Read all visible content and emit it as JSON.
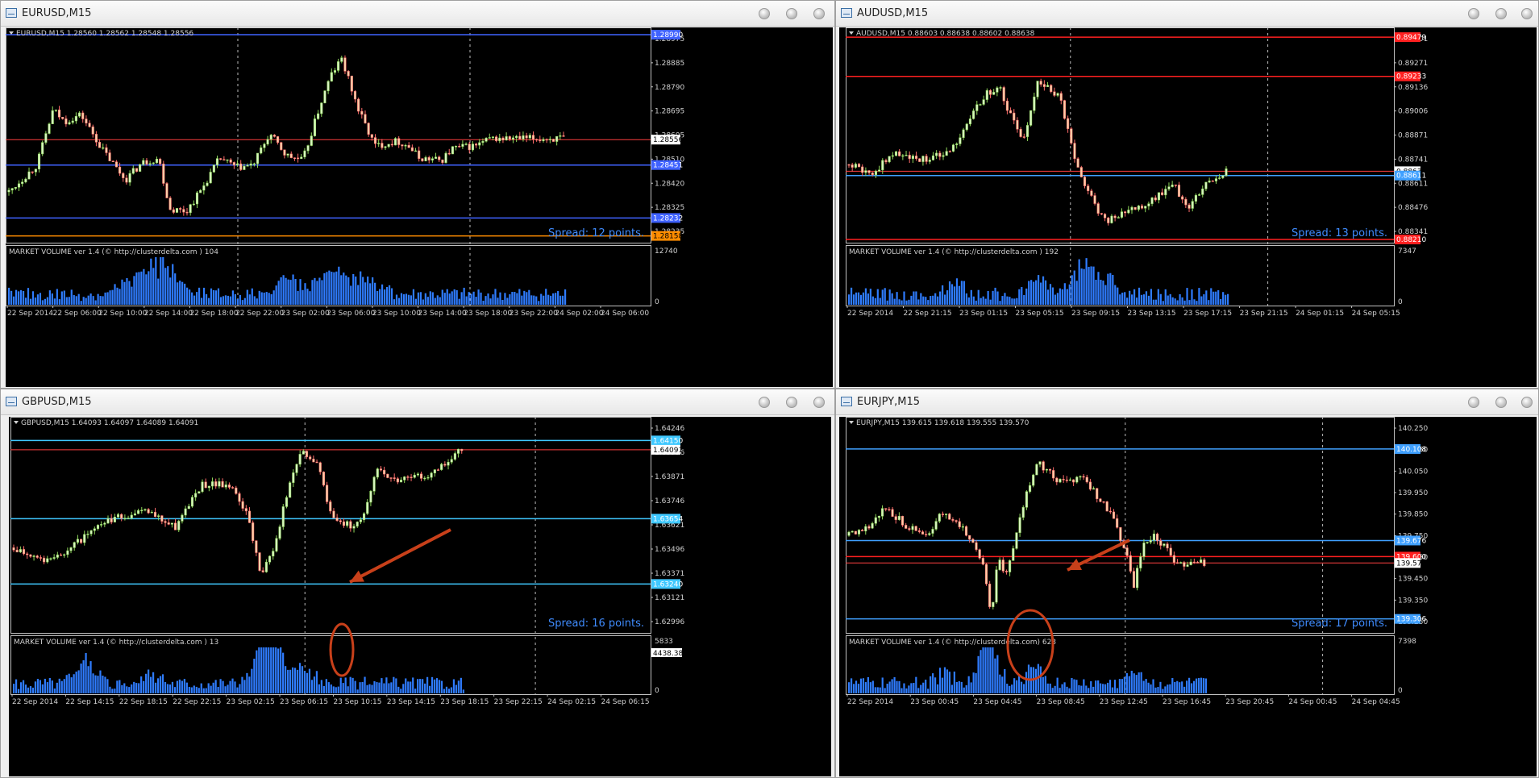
{
  "chart_data": [
    {
      "type": "candlestick",
      "window_title": "EURUSD,M15",
      "header": "EURUSD,M15  1.28560 1.28562 1.28548 1.28556",
      "yticks": [
        "1.28975",
        "1.28885",
        "1.28790",
        "1.28695",
        "1.28605",
        "1.28510",
        "1.28420",
        "1.28325",
        "1.28235"
      ],
      "ylim": [
        1.2813,
        1.2902
      ],
      "levels": [
        {
          "value": 1.2899,
          "label": "1.28990",
          "color": "#3f62ff"
        },
        {
          "value": 1.28556,
          "label": "1.28556",
          "color": "#ffffff"
        },
        {
          "value": 1.28451,
          "label": "1.28451",
          "color": "#3f62ff"
        },
        {
          "value": 1.28232,
          "label": "1.28232",
          "color": "#3f62ff"
        },
        {
          "value": 1.28158,
          "label": "1.28158",
          "color": "#ff8c00"
        }
      ],
      "spread": "Spread: 12 points.",
      "volume_header": "MARKET VOLUME ver 1.4 (© http://clusterdelta.com ) 104",
      "volume_max": "12740",
      "volume_min": "0",
      "xticks": [
        "22 Sep 2014",
        "22 Sep 06:00",
        "22 Sep 10:00",
        "22 Sep 14:00",
        "22 Sep 18:00",
        "22 Sep 22:00",
        "23 Sep 02:00",
        "23 Sep 06:00",
        "23 Sep 10:00",
        "23 Sep 14:00",
        "23 Sep 18:00",
        "23 Sep 22:00",
        "24 Sep 02:00",
        "24 Sep 06:00"
      ],
      "path": [
        [
          0,
          1.2834
        ],
        [
          0.05,
          1.2845
        ],
        [
          0.08,
          1.2868
        ],
        [
          0.1,
          1.2863
        ],
        [
          0.13,
          1.2866
        ],
        [
          0.17,
          1.2851
        ],
        [
          0.21,
          1.2839
        ],
        [
          0.24,
          1.2846
        ],
        [
          0.27,
          1.2848
        ],
        [
          0.29,
          1.2827
        ],
        [
          0.32,
          1.2826
        ],
        [
          0.35,
          1.2836
        ],
        [
          0.38,
          1.2848
        ],
        [
          0.41,
          1.2844
        ],
        [
          0.44,
          1.2845
        ],
        [
          0.47,
          1.2858
        ],
        [
          0.5,
          1.2849
        ],
        [
          0.53,
          1.2847
        ],
        [
          0.56,
          1.2869
        ],
        [
          0.58,
          1.2882
        ],
        [
          0.6,
          1.2889
        ],
        [
          0.63,
          1.2868
        ],
        [
          0.66,
          1.2853
        ],
        [
          0.7,
          1.2855
        ],
        [
          0.72,
          1.2853
        ],
        [
          0.74,
          1.2848
        ],
        [
          0.78,
          1.2847
        ],
        [
          0.8,
          1.2852
        ],
        [
          0.84,
          1.2853
        ],
        [
          0.87,
          1.2856
        ]
      ],
      "volume_peaks": [
        [
          0.28,
          0.95
        ],
        [
          0.58,
          0.7
        ],
        [
          0.64,
          0.5
        ],
        [
          0.23,
          0.55
        ],
        [
          0.5,
          0.45
        ]
      ]
    },
    {
      "type": "candlestick",
      "window_title": "AUDUSD,M15",
      "header": "AUDUSD,M15  0.88603 0.88638 0.88602 0.88638",
      "yticks": [
        "0.89401",
        "0.89271",
        "0.89136",
        "0.89006",
        "0.88871",
        "0.88741",
        "0.88611",
        "0.88476",
        "0.88341"
      ],
      "ylim": [
        0.8819,
        0.8954
      ],
      "levels": [
        {
          "value": 0.89479,
          "label": "0.89479",
          "color": "#ff2020"
        },
        {
          "value": 0.89233,
          "label": "0.89233",
          "color": "#ff2020"
        },
        {
          "value": 0.88638,
          "label": "0.88638",
          "color": "#ffffff"
        },
        {
          "value": 0.88611,
          "label": "0.88611",
          "color": "#3fa0ff"
        },
        {
          "value": 0.8821,
          "label": "0.88210",
          "color": "#ff2020"
        }
      ],
      "spread": "Spread: 13 points.",
      "volume_header": "MARKET VOLUME ver 1.4 (© http://clusterdelta.com ) 192",
      "volume_max": "7347",
      "volume_min": "0",
      "xticks": [
        "22 Sep 2014",
        "22 Sep 21:15",
        "23 Sep 01:15",
        "23 Sep 05:15",
        "23 Sep 09:15",
        "23 Sep 13:15",
        "23 Sep 17:15",
        "23 Sep 21:15",
        "24 Sep 01:15",
        "24 Sep 05:15"
      ],
      "path": [
        [
          0,
          0.8868
        ],
        [
          0.06,
          0.8862
        ],
        [
          0.12,
          0.8876
        ],
        [
          0.18,
          0.887
        ],
        [
          0.25,
          0.8874
        ],
        [
          0.3,
          0.8887
        ],
        [
          0.36,
          0.8912
        ],
        [
          0.4,
          0.8915
        ],
        [
          0.46,
          0.8882
        ],
        [
          0.5,
          0.8921
        ],
        [
          0.56,
          0.8909
        ],
        [
          0.6,
          0.887
        ],
        [
          0.64,
          0.8848
        ],
        [
          0.68,
          0.8832
        ],
        [
          0.74,
          0.8838
        ],
        [
          0.8,
          0.8845
        ],
        [
          0.86,
          0.8855
        ],
        [
          0.9,
          0.8842
        ],
        [
          0.95,
          0.8858
        ],
        [
          1,
          0.8864
        ]
      ],
      "volume_peaks": [
        [
          0.63,
          0.85
        ],
        [
          0.68,
          0.5
        ],
        [
          0.59,
          0.35
        ],
        [
          0.28,
          0.35
        ],
        [
          0.5,
          0.4
        ]
      ]
    },
    {
      "type": "candlestick",
      "window_title": "GBPUSD,M15",
      "header": "GBPUSD,M15  1.64093 1.64097 1.64089 1.64091",
      "yticks": [
        "1.64246",
        "1.63996",
        "1.63871",
        "1.63746",
        "1.63621",
        "1.63496",
        "1.63371",
        "1.63121",
        "1.62996"
      ],
      "ylim": [
        1.6293,
        1.643
      ],
      "levels": [
        {
          "value": 1.6415,
          "label": "1.64150",
          "color": "#3fc8ff"
        },
        {
          "value": 1.64091,
          "label": "1.64091",
          "color": "#ffffff"
        },
        {
          "value": 1.63654,
          "label": "1.63654",
          "color": "#3fc8ff"
        },
        {
          "value": 1.6324,
          "label": "1.63240",
          "color": "#3fc8ff"
        }
      ],
      "spread": "Spread: 16 points.",
      "volume_header": "MARKET VOLUME ver 1.4 (© http://clusterdelta.com ) 13",
      "volume_max": "5833",
      "volume_level": "4438.384",
      "volume_min": "0",
      "xticks": [
        "22 Sep 2014",
        "22 Sep 14:15",
        "22 Sep 18:15",
        "22 Sep 22:15",
        "23 Sep 02:15",
        "23 Sep 06:15",
        "23 Sep 10:15",
        "23 Sep 14:15",
        "23 Sep 18:15",
        "23 Sep 22:15",
        "24 Sep 02:15",
        "24 Sep 06:15"
      ],
      "path": [
        [
          0,
          1.6347
        ],
        [
          0.08,
          1.6338
        ],
        [
          0.15,
          1.6352
        ],
        [
          0.22,
          1.6365
        ],
        [
          0.3,
          1.637
        ],
        [
          0.36,
          1.636
        ],
        [
          0.42,
          1.6387
        ],
        [
          0.48,
          1.6388
        ],
        [
          0.52,
          1.637
        ],
        [
          0.55,
          1.633
        ],
        [
          0.58,
          1.6347
        ],
        [
          0.61,
          1.638
        ],
        [
          0.64,
          1.6408
        ],
        [
          0.68,
          1.64
        ],
        [
          0.71,
          1.6365
        ],
        [
          0.75,
          1.6361
        ],
        [
          0.78,
          1.6365
        ],
        [
          0.81,
          1.6398
        ],
        [
          0.85,
          1.639
        ],
        [
          0.9,
          1.6392
        ],
        [
          0.94,
          1.6395
        ],
        [
          1,
          1.6409
        ]
      ],
      "volume_peaks": [
        [
          0.56,
          1.0
        ],
        [
          0.58,
          0.7
        ],
        [
          0.16,
          0.75
        ],
        [
          0.64,
          0.5
        ],
        [
          0.3,
          0.35
        ]
      ]
    },
    {
      "type": "candlestick",
      "window_title": "EURJPY,M15",
      "header": "EURJPY,M15  139.615 139.618 139.555 139.570",
      "yticks": [
        "140.250",
        "140.150",
        "140.050",
        "139.950",
        "139.850",
        "139.750",
        "139.650",
        "139.450",
        "139.350",
        "139.250"
      ],
      "ylim": [
        139.24,
        140.26
      ],
      "levels": [
        {
          "value": 140.108,
          "label": "140.108",
          "color": "#3fa0ff"
        },
        {
          "value": 139.676,
          "label": "139.676",
          "color": "#3fa0ff"
        },
        {
          "value": 139.6,
          "label": "139.600",
          "color": "#ff2020"
        },
        {
          "value": 139.57,
          "label": "139.570",
          "color": "#ffffff"
        },
        {
          "value": 139.306,
          "label": "139.306",
          "color": "#3fa0ff"
        }
      ],
      "spread": "Spread: 17 points.",
      "volume_header": "MARKET VOLUME ver 1.4 (© http://clusterdelta.com) 623",
      "volume_max": "7398",
      "volume_min": "0",
      "xticks": [
        "22 Sep 2014",
        "23 Sep 00:45",
        "23 Sep 04:45",
        "23 Sep 08:45",
        "23 Sep 12:45",
        "23 Sep 16:45",
        "23 Sep 20:45",
        "24 Sep 00:45",
        "24 Sep 04:45"
      ],
      "path": [
        [
          0,
          139.7
        ],
        [
          0.06,
          139.74
        ],
        [
          0.1,
          139.83
        ],
        [
          0.16,
          139.75
        ],
        [
          0.22,
          139.7
        ],
        [
          0.26,
          139.8
        ],
        [
          0.32,
          139.74
        ],
        [
          0.36,
          139.62
        ],
        [
          0.38,
          139.55
        ],
        [
          0.4,
          139.32
        ],
        [
          0.42,
          139.6
        ],
        [
          0.44,
          139.5
        ],
        [
          0.47,
          139.7
        ],
        [
          0.5,
          139.9
        ],
        [
          0.53,
          140.05
        ],
        [
          0.56,
          140.0
        ],
        [
          0.6,
          139.95
        ],
        [
          0.66,
          139.98
        ],
        [
          0.7,
          139.88
        ],
        [
          0.74,
          139.8
        ],
        [
          0.78,
          139.62
        ],
        [
          0.8,
          139.45
        ],
        [
          0.83,
          139.66
        ],
        [
          0.86,
          139.7
        ],
        [
          0.9,
          139.62
        ],
        [
          0.92,
          139.57
        ]
      ],
      "volume_peaks": [
        [
          0.38,
          1.0
        ],
        [
          0.4,
          0.7
        ],
        [
          0.52,
          0.5
        ],
        [
          0.27,
          0.3
        ],
        [
          0.8,
          0.4
        ]
      ]
    }
  ]
}
